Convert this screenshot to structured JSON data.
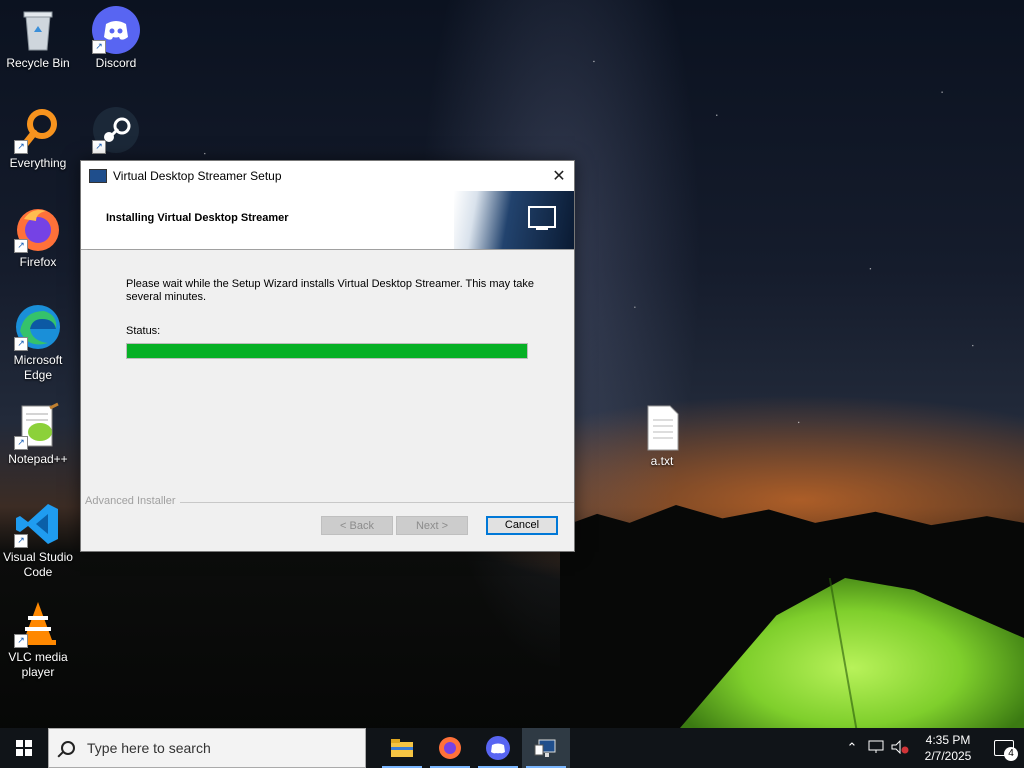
{
  "desktop": {
    "icons": [
      {
        "label": "Recycle Bin",
        "icon": "recycle-bin-icon"
      },
      {
        "label": "Discord",
        "icon": "discord-icon"
      },
      {
        "label": "Everything",
        "icon": "everything-search-icon"
      },
      {
        "label": "",
        "icon": "steam-icon"
      },
      {
        "label": "Firefox",
        "icon": "firefox-icon"
      },
      {
        "label": "Microsoft Edge",
        "icon": "edge-icon"
      },
      {
        "label": "Notepad++",
        "icon": "notepadpp-icon"
      },
      {
        "label": "Visual Studio Code",
        "icon": "vscode-icon"
      },
      {
        "label": "VLC media player",
        "icon": "vlc-icon"
      },
      {
        "label": "a.txt",
        "icon": "text-file-icon"
      }
    ]
  },
  "dialog": {
    "title": "Virtual Desktop Streamer Setup",
    "heading": "Installing Virtual Desktop Streamer",
    "message": "Please wait while the Setup Wizard installs Virtual Desktop Streamer.  This may take several minutes.",
    "status_label": "Status:",
    "progress": 1.0,
    "branding": "Advanced Installer",
    "buttons": {
      "back": "< Back",
      "next": "Next >",
      "cancel": "Cancel"
    },
    "close_glyph": "✕"
  },
  "taskbar": {
    "search_placeholder": "Type here to search",
    "apps": [
      {
        "name": "File Explorer",
        "icon": "file-explorer-icon"
      },
      {
        "name": "Firefox",
        "icon": "firefox-icon"
      },
      {
        "name": "Discord",
        "icon": "discord-icon"
      },
      {
        "name": "Virtual Desktop Streamer Setup",
        "icon": "setup-icon",
        "active": true
      }
    ],
    "time": "4:35 PM",
    "date": "2/7/2025",
    "notification_count": "4"
  },
  "colors": {
    "progress": "#06b025",
    "accent": "#0078d7"
  }
}
